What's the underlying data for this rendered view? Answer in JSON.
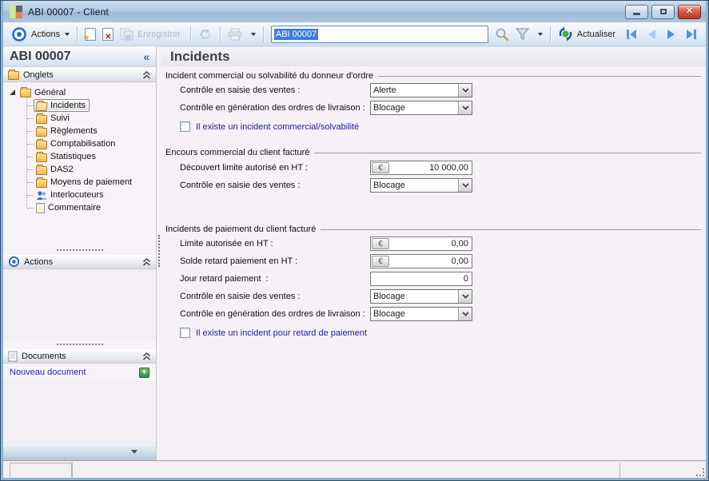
{
  "window": {
    "title": "ABI 00007 -  Client"
  },
  "toolbar": {
    "actions_label": "Actions",
    "save_label": "Enregistrer",
    "search_value": "ABI 00007",
    "refresh_label": "Actualiser"
  },
  "sidebar": {
    "record_id": "ABI 00007",
    "collapse_glyph": "«",
    "onglets_title": "Onglets",
    "actions_title": "Actions",
    "documents_title": "Documents",
    "new_document_label": "Nouveau document",
    "new_document_plus": "+",
    "tree": {
      "root_label": "Général",
      "items": [
        {
          "label": "Incidents",
          "icon": "folder-open",
          "selected": true
        },
        {
          "label": "Suivi",
          "icon": "folder",
          "selected": false
        },
        {
          "label": "Règlements",
          "icon": "folder",
          "selected": false
        },
        {
          "label": "Comptabilisation",
          "icon": "folder",
          "selected": false
        },
        {
          "label": "Statistiques",
          "icon": "folder",
          "selected": false
        },
        {
          "label": "DAS2",
          "icon": "folder",
          "selected": false
        },
        {
          "label": "Moyens de paiement",
          "icon": "folder",
          "selected": false
        },
        {
          "label": "Interlocuteurs",
          "icon": "people",
          "selected": false
        },
        {
          "label": "Commentaire",
          "icon": "note",
          "selected": false
        }
      ]
    }
  },
  "main": {
    "title": "Incidents",
    "currency_symbol": "€",
    "groups": [
      {
        "legend": "Incident commercial ou solvabilité du donneur d'ordre",
        "rows": [
          {
            "label": "Contrôle en saisie des ventes :",
            "type": "select",
            "value": "Alerte"
          },
          {
            "label": "Contrôle en génération des ordres de livraison :",
            "type": "select",
            "value": "Blocage"
          }
        ],
        "checkbox": {
          "label": "Il existe un incident commercial/solvabilité",
          "checked": false
        }
      },
      {
        "legend": "Encours commercial du client facturé",
        "rows": [
          {
            "label": "Découvert limite autorisé en HT :",
            "type": "currency",
            "value": "10 000,00"
          },
          {
            "label": "Contrôle en saisie des ventes :",
            "type": "select",
            "value": "Blocage"
          }
        ]
      },
      {
        "legend": "Incidents de paiement du client facturé",
        "rows": [
          {
            "label": "Limite autorisée en HT :",
            "type": "currency",
            "value": "0,00"
          },
          {
            "label": "Solde retard paiement en HT :",
            "type": "currency",
            "value": "0,00"
          },
          {
            "label": "Jour retard paiement  :",
            "type": "number",
            "value": "0"
          },
          {
            "label": "Contrôle en saisie des ventes :",
            "type": "select",
            "value": "Blocage"
          },
          {
            "label": "Contrôle en génération des ordres de livraison :",
            "type": "select",
            "value": "Blocage"
          }
        ],
        "checkbox": {
          "label": "Il existe un incident pour retard de paiement",
          "checked": false
        }
      }
    ]
  }
}
